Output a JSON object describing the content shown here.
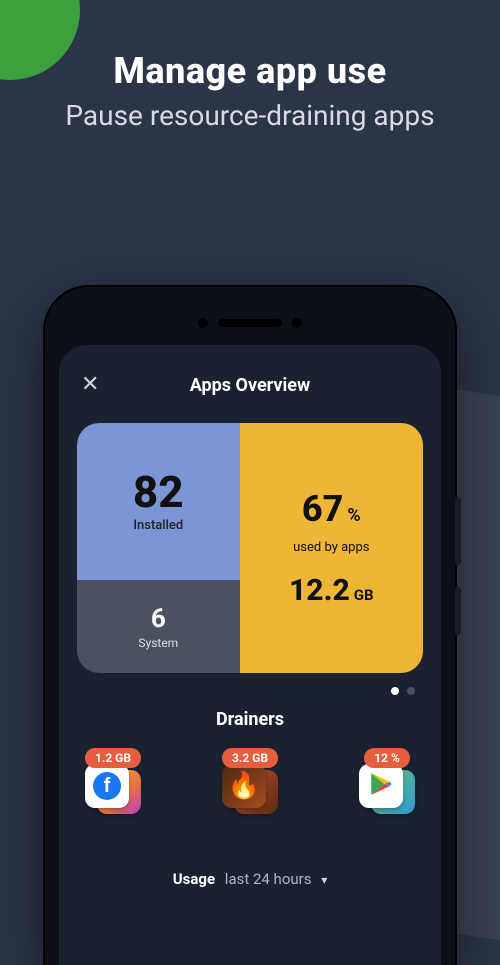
{
  "hero": {
    "title": "Manage app use",
    "subtitle": "Pause resource-draining apps"
  },
  "screen": {
    "title": "Apps Overview",
    "close_label": "✕"
  },
  "stats": {
    "installed": {
      "count": "82",
      "label": "Installed"
    },
    "system": {
      "count": "6",
      "label": "System"
    },
    "usage": {
      "percent": "67",
      "percent_sign": "%",
      "used_label": "used by apps",
      "size": "12.2",
      "size_unit": "GB"
    }
  },
  "drainers": {
    "title": "Drainers",
    "items": [
      {
        "badge": "1.2 GB",
        "icon": "facebook-icon"
      },
      {
        "badge": "3.2 GB",
        "icon": "game-icon"
      },
      {
        "badge": "12 %",
        "icon": "play-store-icon"
      }
    ]
  },
  "usage_bar": {
    "label": "Usage",
    "period": "last 24 hours"
  }
}
